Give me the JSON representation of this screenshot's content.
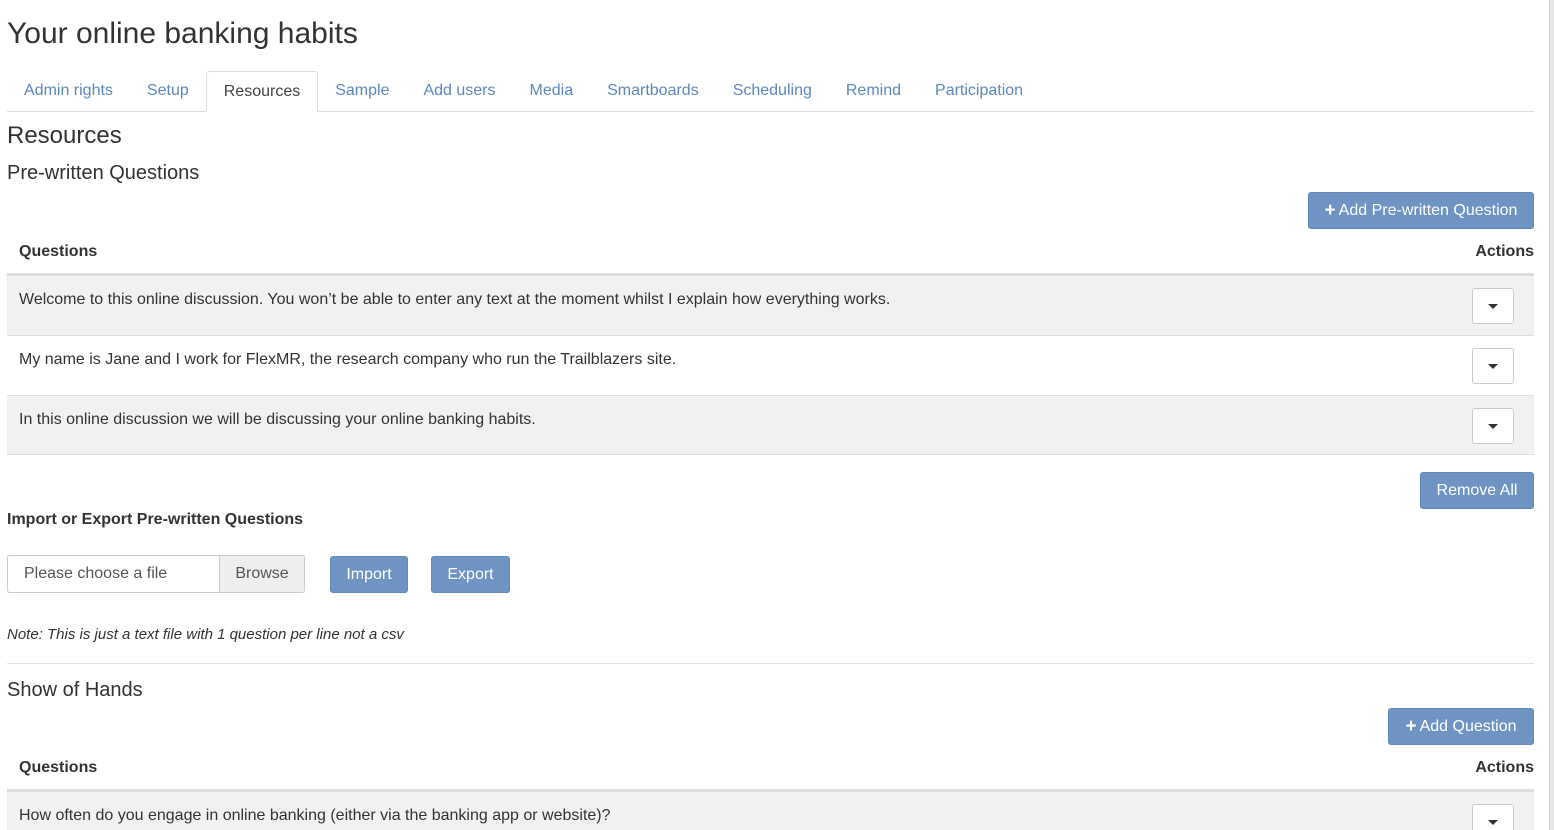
{
  "page": {
    "title": "Your online banking habits"
  },
  "tabs": [
    {
      "label": "Admin rights",
      "active": false
    },
    {
      "label": "Setup",
      "active": false
    },
    {
      "label": "Resources",
      "active": true
    },
    {
      "label": "Sample",
      "active": false
    },
    {
      "label": "Add users",
      "active": false
    },
    {
      "label": "Media",
      "active": false
    },
    {
      "label": "Smartboards",
      "active": false
    },
    {
      "label": "Scheduling",
      "active": false
    },
    {
      "label": "Remind",
      "active": false
    },
    {
      "label": "Participation",
      "active": false
    }
  ],
  "resources": {
    "heading": "Resources",
    "prewritten": {
      "heading": "Pre-written Questions",
      "add_button": "Add Pre-written Question",
      "col_questions": "Questions",
      "col_actions": "Actions",
      "rows": [
        "Welcome to this online discussion. You won’t be able to enter any text at the moment whilst I explain how everything works.",
        "My name is Jane and I work for FlexMR, the research company who run the Trailblazers site.",
        "In this online discussion we will be discussing your online banking habits."
      ],
      "remove_all_button": "Remove All"
    },
    "import_export": {
      "heading": "Import or Export Pre-written Questions",
      "file_placeholder": "Please choose a file",
      "browse_button": "Browse",
      "import_button": "Import",
      "export_button": "Export",
      "note": "Note: This is just a text file with 1 question per line not a csv"
    },
    "show_of_hands": {
      "heading": "Show of Hands",
      "add_button": "Add Question",
      "col_questions": "Questions",
      "col_actions": "Actions",
      "rows": [
        "How often do you engage in online banking (either via the banking app or website)?"
      ]
    }
  },
  "colors": {
    "primary_button": "#6f93c3",
    "tab_link": "#5d88bf",
    "stripe": "#f1f1f1"
  }
}
